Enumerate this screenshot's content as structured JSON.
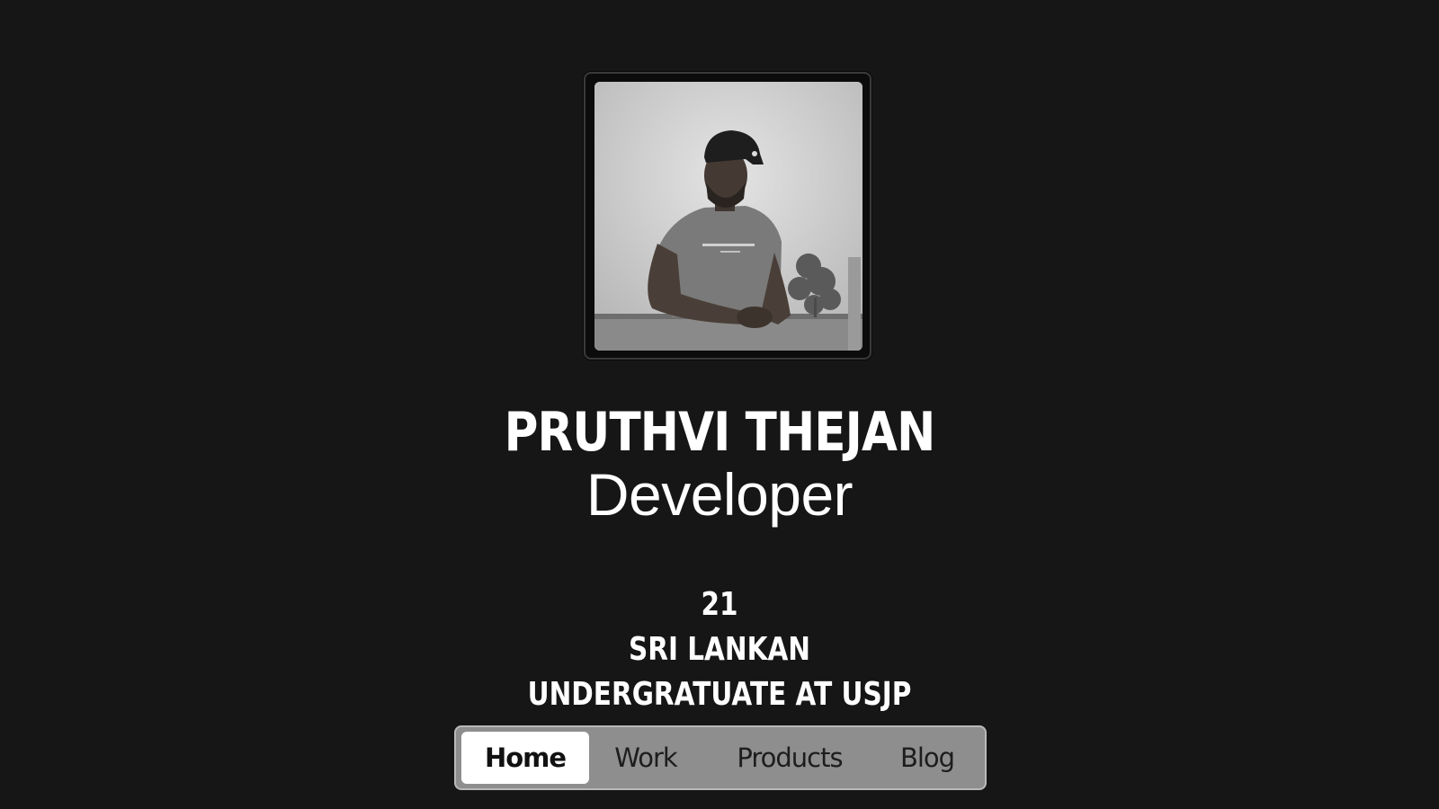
{
  "profile": {
    "photo_alt": "portrait-photo",
    "name": "Pruthvi Thejan",
    "role": "Developer"
  },
  "facts": [
    "21",
    "Sri Lankan",
    "Undergratuate at USJP"
  ],
  "nav": {
    "items": [
      {
        "label": "Home",
        "active": true
      },
      {
        "label": "Work",
        "active": false
      },
      {
        "label": "Products",
        "active": false
      },
      {
        "label": "Blog",
        "active": false
      }
    ]
  },
  "colors": {
    "background": "#161616",
    "text": "#ffffff",
    "nav_background": "#8e8e8e",
    "nav_active": "#ffffff"
  }
}
